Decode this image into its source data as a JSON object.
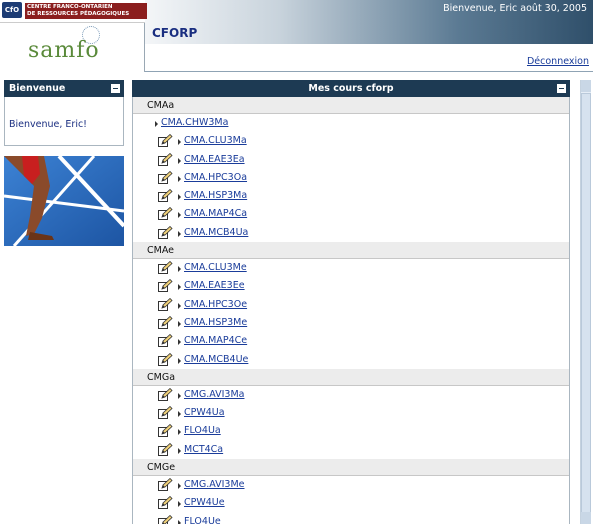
{
  "header": {
    "org_badge": "CfO",
    "org_line1": "CENTRE FRANCO-ONTARIEN",
    "org_line2": "DE RESSOURCES PÉDAGOGIQUES",
    "logo_text": "samfo",
    "welcome": "Bienvenue, Eric  août 30, 2005",
    "site_title": "CFORP",
    "logout": "Déconnexion"
  },
  "left_panel": {
    "title": "Bienvenue",
    "message": "Bienvenue, Eric!"
  },
  "main_panel": {
    "title": "Mes cours cforp",
    "groups": [
      {
        "name": "CMAa",
        "courses": [
          {
            "code": "CMA.CHW3Ma",
            "edit": false
          },
          {
            "code": "CMA.CLU3Ma",
            "edit": true
          },
          {
            "code": "CMA.EAE3Ea",
            "edit": true
          },
          {
            "code": "CMA.HPC3Oa",
            "edit": true
          },
          {
            "code": "CMA.HSP3Ma",
            "edit": true
          },
          {
            "code": "CMA.MAP4Ca",
            "edit": true
          },
          {
            "code": "CMA.MCB4Ua",
            "edit": true
          }
        ]
      },
      {
        "name": "CMAe",
        "courses": [
          {
            "code": "CMA.CLU3Me",
            "edit": true
          },
          {
            "code": "CMA.EAE3Ee",
            "edit": true
          },
          {
            "code": "CMA.HPC3Oe",
            "edit": true
          },
          {
            "code": "CMA.HSP3Me",
            "edit": true
          },
          {
            "code": "CMA.MAP4Ce",
            "edit": true
          },
          {
            "code": "CMA.MCB4Ue",
            "edit": true
          }
        ]
      },
      {
        "name": "CMGa",
        "courses": [
          {
            "code": "CMG.AVI3Ma",
            "edit": true
          },
          {
            "code": "CPW4Ua",
            "edit": true
          },
          {
            "code": "FLO4Ua",
            "edit": true
          },
          {
            "code": "MCT4Ca",
            "edit": true
          }
        ]
      },
      {
        "name": "CMGe",
        "courses": [
          {
            "code": "CMG.AVI3Me",
            "edit": true
          },
          {
            "code": "CPW4Ue",
            "edit": true
          },
          {
            "code": "FLO4Ue",
            "edit": true
          }
        ]
      }
    ]
  },
  "icons": {
    "edit": "pencil-edit-icon",
    "bullet": "triangle-bullet-icon",
    "collapse": "minimize-box-icon"
  },
  "colors": {
    "panel_header": "#1d3a53",
    "link": "#1a3c9a",
    "title": "#1a2e80",
    "group_bg": "#ececec"
  }
}
